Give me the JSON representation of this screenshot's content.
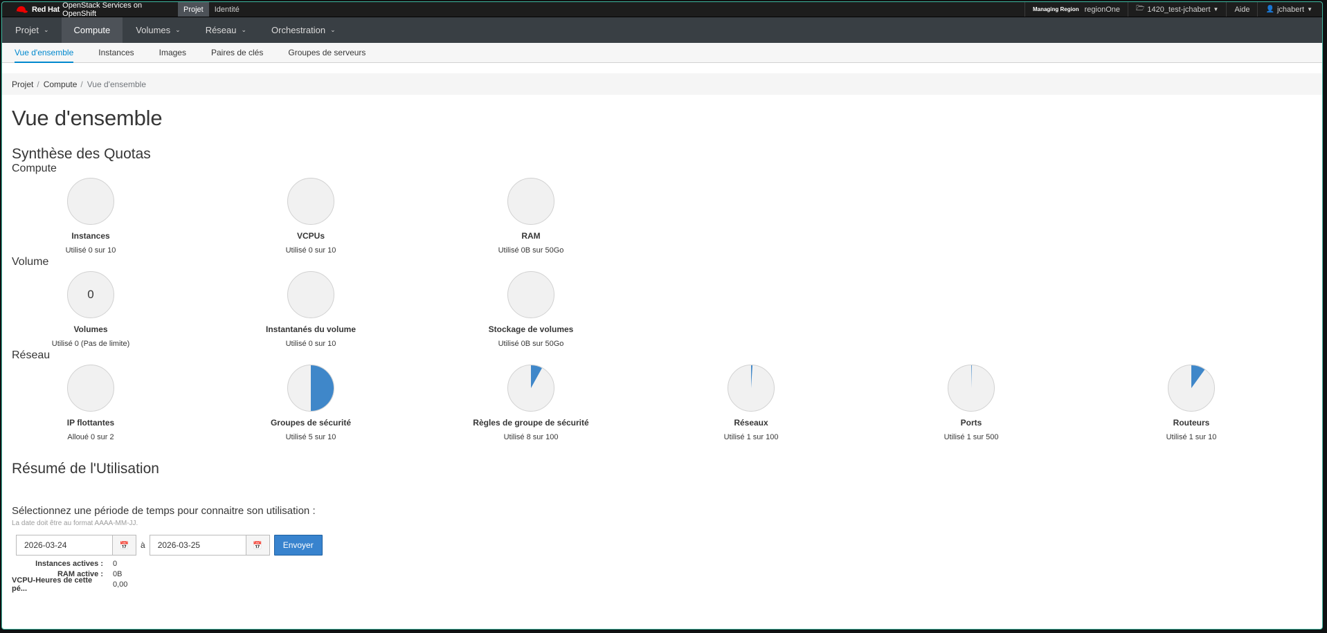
{
  "masthead": {
    "brand_bold": "Red Hat",
    "brand_rest": "OpenStack Services on OpenShift",
    "tabs": [
      "Projet",
      "Identité"
    ],
    "region_label": "Managing Region",
    "region_value": "regionOne",
    "project": "1420_test-jchabert",
    "help": "Aide",
    "user": "jchabert"
  },
  "primary_nav": [
    {
      "label": "Projet",
      "caret": true
    },
    {
      "label": "Compute",
      "caret": false
    },
    {
      "label": "Volumes",
      "caret": true
    },
    {
      "label": "Réseau",
      "caret": true
    },
    {
      "label": "Orchestration",
      "caret": true
    }
  ],
  "secondary_nav": [
    "Vue d'ensemble",
    "Instances",
    "Images",
    "Paires de clés",
    "Groupes de serveurs"
  ],
  "breadcrumb": {
    "items": [
      "Projet",
      "Compute"
    ],
    "current": "Vue d'ensemble"
  },
  "page_title": "Vue d'ensemble",
  "quota_title": "Synthèse des Quotas",
  "groups": [
    {
      "title": "Compute",
      "quotas": [
        {
          "label": "Instances",
          "usage": "Utilisé 0 sur 10",
          "fraction": 0,
          "center": ""
        },
        {
          "label": "VCPUs",
          "usage": "Utilisé 0 sur 10",
          "fraction": 0,
          "center": ""
        },
        {
          "label": "RAM",
          "usage": "Utilisé 0B sur 50Go",
          "fraction": 0,
          "center": ""
        }
      ]
    },
    {
      "title": "Volume",
      "quotas": [
        {
          "label": "Volumes",
          "usage": "Utilisé 0 (Pas de limite)",
          "fraction": 0,
          "center": "0"
        },
        {
          "label": "Instantanés du volume",
          "usage": "Utilisé 0 sur 10",
          "fraction": 0,
          "center": ""
        },
        {
          "label": "Stockage de volumes",
          "usage": "Utilisé 0B sur 50Go",
          "fraction": 0,
          "center": ""
        }
      ]
    },
    {
      "title": "Réseau",
      "quotas": [
        {
          "label": "IP flottantes",
          "usage": "Alloué 0 sur 2",
          "fraction": 0,
          "center": ""
        },
        {
          "label": "Groupes de sécurité",
          "usage": "Utilisé 5 sur 10",
          "fraction": 0.5,
          "center": ""
        },
        {
          "label": "Règles de groupe de sécurité",
          "usage": "Utilisé 8 sur 100",
          "fraction": 0.08,
          "center": ""
        },
        {
          "label": "Réseaux",
          "usage": "Utilisé 1 sur 100",
          "fraction": 0.01,
          "center": ""
        },
        {
          "label": "Ports",
          "usage": "Utilisé 1 sur 500",
          "fraction": 0.002,
          "center": ""
        },
        {
          "label": "Routeurs",
          "usage": "Utilisé 1 sur 10",
          "fraction": 0.1,
          "center": ""
        }
      ]
    }
  ],
  "usage": {
    "title": "Résumé de l'Utilisation",
    "period_title": "Sélectionnez une période de temps pour connaitre son utilisation :",
    "help": "La date doit être au format AAAA-MM-JJ.",
    "start": "2026-03-24",
    "separator": "à",
    "end": "2026-03-25",
    "submit": "Envoyer",
    "stats": [
      {
        "label": "Instances actives :",
        "value": "0"
      },
      {
        "label": "RAM active :",
        "value": "0B"
      },
      {
        "label": "VCPU-Heures de cette pé...",
        "value": "0,00"
      }
    ]
  },
  "colors": {
    "accent": "#0088ce",
    "pie_fill": "#3f87c9",
    "pie_bg": "#f1f1f1",
    "button": "#3883ce"
  },
  "icons": {
    "project": "folder-icon",
    "user": "user-icon",
    "calendar": "calendar-icon",
    "brand": "red-hat-logo-icon"
  }
}
